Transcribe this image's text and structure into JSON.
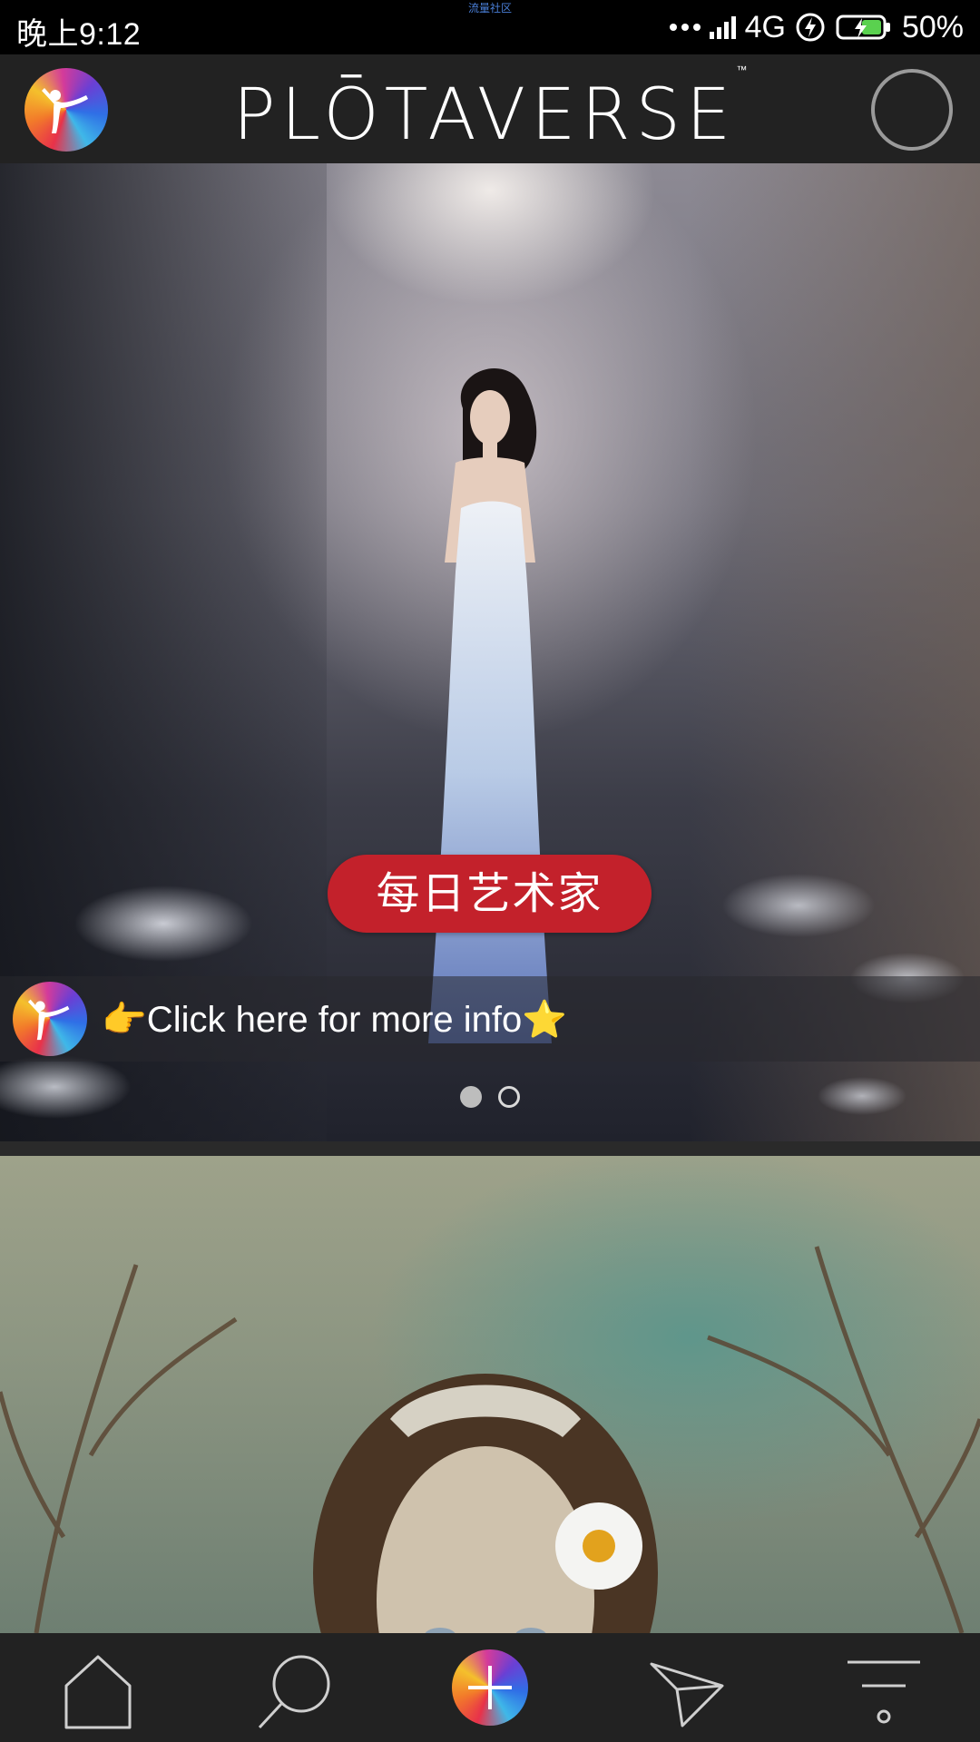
{
  "status_bar": {
    "time": "晚上9:12",
    "center_label": "流量社区",
    "network": "4G",
    "battery": "50%"
  },
  "header": {
    "brand": "PLŌTAVERSE",
    "trademark": "™"
  },
  "hero": {
    "badge_label": "每日艺术家",
    "info_text": "👉Click here for more info⭐",
    "pager_count": 2,
    "pager_active": 1
  },
  "nav": {
    "items": [
      "home-icon",
      "search-icon",
      "add-icon",
      "send-icon",
      "menu-icon"
    ]
  },
  "colors": {
    "accent_red": "#c3212b",
    "header_bg": "#222222"
  }
}
